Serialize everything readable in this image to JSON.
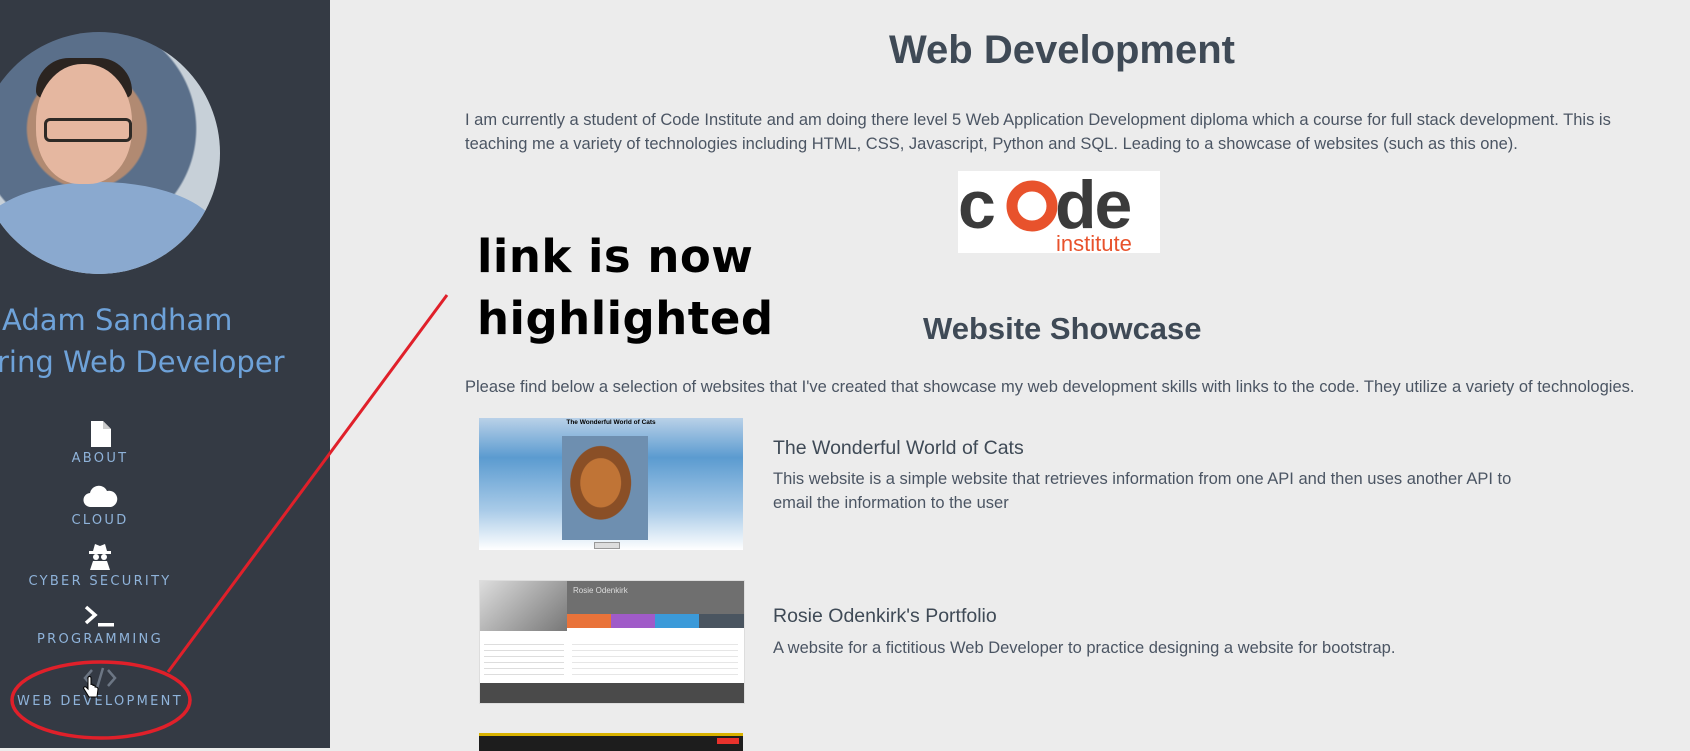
{
  "sidebar": {
    "name": "Adam Sandham",
    "role": "ring Web Developer",
    "nav": [
      {
        "label": "ABOUT",
        "icon": "file-icon"
      },
      {
        "label": "CLOUD",
        "icon": "cloud-icon"
      },
      {
        "label": "CYBER SECURITY",
        "icon": "spy-icon"
      },
      {
        "label": "PROGRAMMING",
        "icon": "terminal-icon"
      },
      {
        "label": "WEB DEVELOPMENT",
        "icon": "code-icon"
      }
    ]
  },
  "main": {
    "title": "Web Development",
    "intro": "I am currently a student of Code Institute and am doing there level 5 Web Application Development diploma which a course for full stack development. This is teaching me a variety of technologies including HTML, CSS, Javascript, Python and SQL. Leading to a showcase of websites (such as this one).",
    "logo": {
      "word": "code",
      "sub": "institute"
    },
    "showcase_title": "Website Showcase",
    "showcase_intro": "Please find below a selection of websites that I've created that showcase my web development skills with links to the code. They utilize a variety of technologies.",
    "projects": [
      {
        "title": "The Wonderful World of Cats",
        "desc": "This website is a simple website that retrieves information from one API and then uses another API to email the information to the user",
        "thumb_title": "The Wonderful World of Cats"
      },
      {
        "title": "Rosie Odenkirk's Portfolio",
        "desc": "A website for a fictitious Web Developer to practice designing a website for bootstrap.",
        "thumb_title": "Rosie Odenkirk"
      }
    ]
  },
  "annotation": {
    "line1": "link is now",
    "line2": "highlighted"
  },
  "colors": {
    "sidebar_bg": "#343a44",
    "accent": "#6ea2d9",
    "annotation_red": "#e0202a",
    "logo_orange": "#e8522c"
  }
}
